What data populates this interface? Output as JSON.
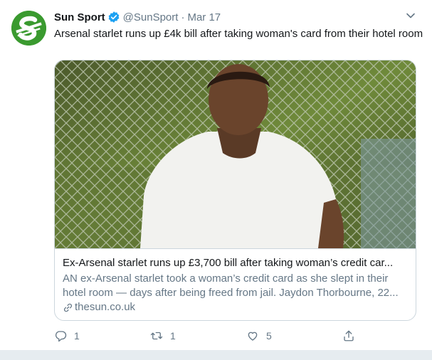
{
  "tweet": {
    "author_name": "Sun Sport",
    "handle": "@SunSport",
    "separator": "·",
    "date": "Mar 17",
    "text": "Arsenal starlet runs up £4k bill after taking woman's card from their hotel room",
    "verified": true,
    "avatar_color": "#3a9a2f"
  },
  "card": {
    "title": "Ex-Arsenal starlet runs up £3,700 bill after taking woman’s credit car...",
    "description": "AN ex-Arsenal starlet took a woman’s credit card as she slept in their hotel room — days after being freed from jail. Jaydon Thorbourne, 22...",
    "domain": "thesun.co.uk",
    "link_icon": "link-icon"
  },
  "actions": {
    "reply_count": "1",
    "retweet_count": "1",
    "like_count": "5"
  },
  "colors": {
    "verified": "#1da1f2",
    "secondary_text": "#657786",
    "border": "#ccd6dd"
  }
}
